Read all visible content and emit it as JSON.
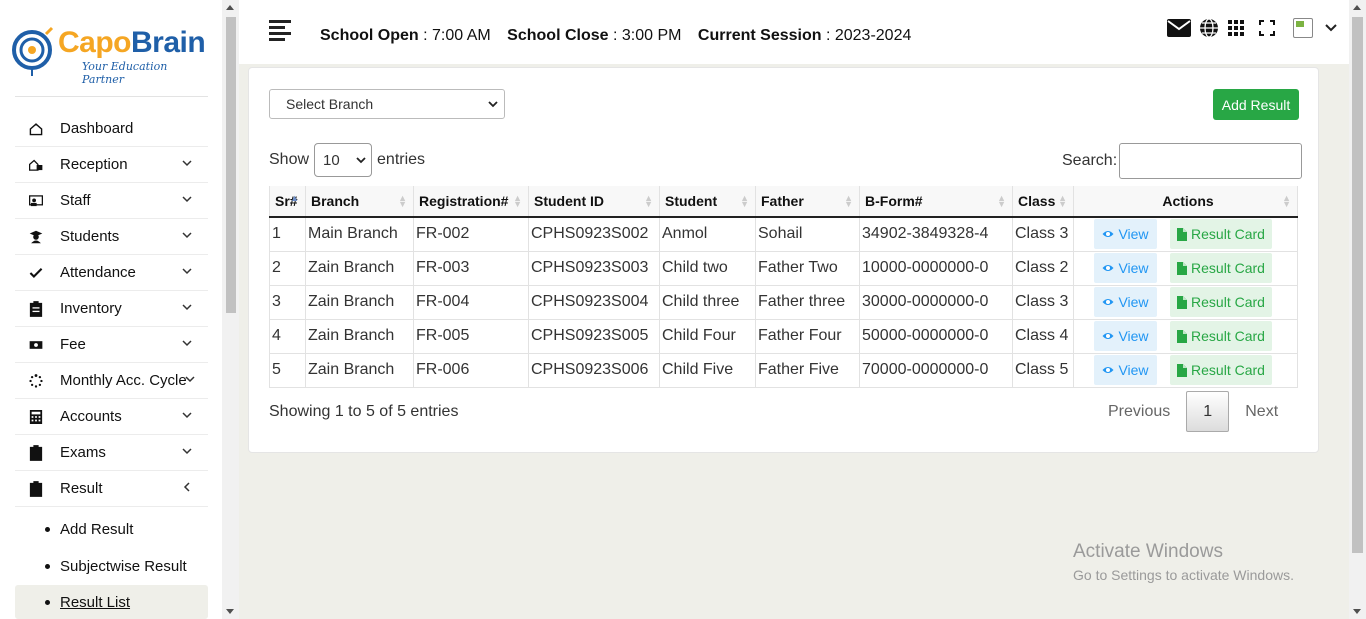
{
  "brand": {
    "name_part1": "Capo",
    "name_part2": "Brain",
    "tagline": "Your Education Partner"
  },
  "sidebar": {
    "items": [
      {
        "label": "Dashboard",
        "icon": "home-icon"
      },
      {
        "label": "Reception",
        "icon": "reception-icon"
      },
      {
        "label": "Staff",
        "icon": "staff-icon"
      },
      {
        "label": "Students",
        "icon": "student-icon"
      },
      {
        "label": "Attendance",
        "icon": "check-icon"
      },
      {
        "label": "Inventory",
        "icon": "clipboard-icon"
      },
      {
        "label": "Fee",
        "icon": "money-icon"
      },
      {
        "label": "Monthly Acc. Cycle",
        "icon": "spinner-icon"
      },
      {
        "label": "Accounts",
        "icon": "calculator-icon"
      },
      {
        "label": "Exams",
        "icon": "clipboard-icon"
      },
      {
        "label": "Result",
        "icon": "clipboard-icon"
      }
    ],
    "result_sub": [
      "Add Result",
      "Subjectwise Result",
      "Result List"
    ]
  },
  "header": {
    "school_open_label": "School Open",
    "school_open_value": ": 7:00 AM",
    "school_close_label": "School Close",
    "school_close_value": ": 3:00 PM",
    "session_label": "Current Session",
    "session_value": ": 2023-2024"
  },
  "filters": {
    "branch_placeholder": "Select Branch",
    "add_result": "Add Result",
    "show_label": "Show",
    "entries_count": "10",
    "entries_label": "entries",
    "search_label": "Search:"
  },
  "table": {
    "columns": [
      "Sr#",
      "Branch",
      "Registration#",
      "Student ID",
      "Student",
      "Father",
      "B-Form#",
      "Class",
      "Actions"
    ],
    "rows": [
      [
        "1",
        "Main Branch",
        "FR-002",
        "CPHS0923S002",
        "Anmol",
        "Sohail",
        "34902-3849328-4",
        "Class 3"
      ],
      [
        "2",
        "Zain Branch",
        "FR-003",
        "CPHS0923S003",
        "Child two",
        "Father Two",
        "10000-0000000-0",
        "Class 2"
      ],
      [
        "3",
        "Zain Branch",
        "FR-004",
        "CPHS0923S004",
        "Child three",
        "Father three",
        "30000-0000000-0",
        "Class 3"
      ],
      [
        "4",
        "Zain Branch",
        "FR-005",
        "CPHS0923S005",
        "Child Four",
        "Father Four",
        "50000-0000000-0",
        "Class 4"
      ],
      [
        "5",
        "Zain Branch",
        "FR-006",
        "CPHS0923S006",
        "Child Five",
        "Father Five",
        "70000-0000000-0",
        "Class 5"
      ]
    ],
    "view_label": "View",
    "result_card_label": "Result Card"
  },
  "footer": {
    "showing": "Showing 1 to 5 of 5 entries",
    "previous": "Previous",
    "page": "1",
    "next": "Next"
  },
  "watermark": {
    "line1": "Activate Windows",
    "line2": "Go to Settings to activate Windows."
  },
  "colors": {
    "brand_orange": "#f5a623",
    "brand_blue": "#1f5fa8",
    "success": "#28a745",
    "info": "#2196f3"
  }
}
